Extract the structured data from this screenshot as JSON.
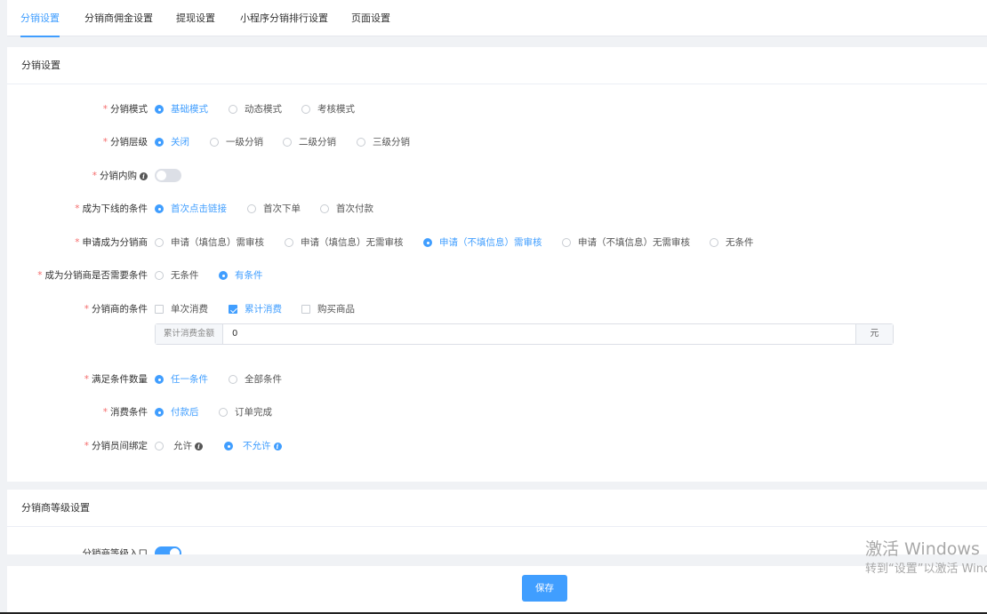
{
  "tabs": [
    {
      "label": "分销设置",
      "active": true
    },
    {
      "label": "分销商佣金设置",
      "active": false
    },
    {
      "label": "提现设置",
      "active": false
    },
    {
      "label": "小程序分销排行设置",
      "active": false
    },
    {
      "label": "页面设置",
      "active": false
    }
  ],
  "section1": {
    "title": "分销设置",
    "fields": {
      "mode": {
        "label": "分销模式",
        "options": [
          "基础模式",
          "动态模式",
          "考核模式"
        ],
        "selected": "基础模式"
      },
      "level": {
        "label": "分销层级",
        "options": [
          "关闭",
          "一级分销",
          "二级分销",
          "三级分销"
        ],
        "selected": "关闭"
      },
      "inner_buy": {
        "label": "分销内购",
        "enabled": false
      },
      "downline": {
        "label": "成为下线的条件",
        "options": [
          "首次点击链接",
          "首次下单",
          "首次付款"
        ],
        "selected": "首次点击链接"
      },
      "apply": {
        "label": "申请成为分销商",
        "options": [
          "申请（填信息）需审核",
          "申请（填信息）无需审核",
          "申请（不填信息）需审核",
          "申请（不填信息）无需审核",
          "无条件"
        ],
        "selected": "申请（不填信息）需审核"
      },
      "need_condition": {
        "label": "成为分销商是否需要条件",
        "options": [
          "无条件",
          "有条件"
        ],
        "selected": "有条件"
      },
      "conditions": {
        "label": "分销商的条件",
        "options": [
          {
            "label": "单次消费",
            "checked": false
          },
          {
            "label": "累计消费",
            "checked": true
          },
          {
            "label": "购买商品",
            "checked": false
          }
        ],
        "amount": {
          "prefix": "累计消费金额",
          "value": "0",
          "suffix": "元"
        }
      },
      "satisfy": {
        "label": "满足条件数量",
        "options": [
          "任一条件",
          "全部条件"
        ],
        "selected": "任一条件"
      },
      "consume": {
        "label": "消费条件",
        "options": [
          "付款后",
          "订单完成"
        ],
        "selected": "付款后"
      },
      "binding": {
        "label": "分销员间绑定",
        "options": [
          "允许",
          "不允许"
        ],
        "selected": "不允许"
      }
    }
  },
  "section2": {
    "title": "分销商等级设置",
    "entry": {
      "label": "分销商等级入口",
      "enabled": true
    }
  },
  "footer": {
    "save_label": "保存"
  },
  "watermark": {
    "line1": "激活 Windows",
    "line2": "转到“设置”以激活 Windows。"
  },
  "colors": {
    "primary": "#409eff",
    "required": "#f56c6c"
  }
}
